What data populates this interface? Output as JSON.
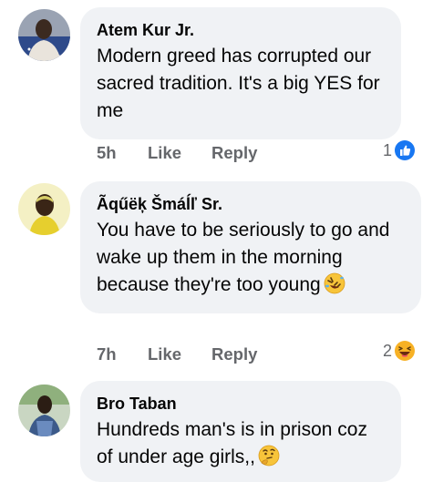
{
  "comments": [
    {
      "name": "Atem Kur Jr.",
      "text": "Modern greed has corrupted our sacred tradition. It's a big YES for me",
      "time": "5h",
      "like_label": "Like",
      "reply_label": "Reply",
      "reaction_count": "1",
      "reaction_icon": "like-icon"
    },
    {
      "name": "Ãqűëķ Šmáĺľ Sr.",
      "text": "You have to be seriously to go and wake up them in the morning because they're too young",
      "trailing_emoji": "rolling-laughing-emoji",
      "time": "7h",
      "like_label": "Like",
      "reply_label": "Reply",
      "reaction_count": "2",
      "reaction_icon": "haha-icon"
    },
    {
      "name": "Bro Taban",
      "text": "Hundreds man's is in prison coz of under age girls,,",
      "trailing_emoji": "thinking-emoji"
    }
  ],
  "colors": {
    "bubble": "#f0f2f5",
    "meta": "#65676b",
    "like_blue": "#1877f2",
    "haha_yellow": "#f7b125"
  }
}
